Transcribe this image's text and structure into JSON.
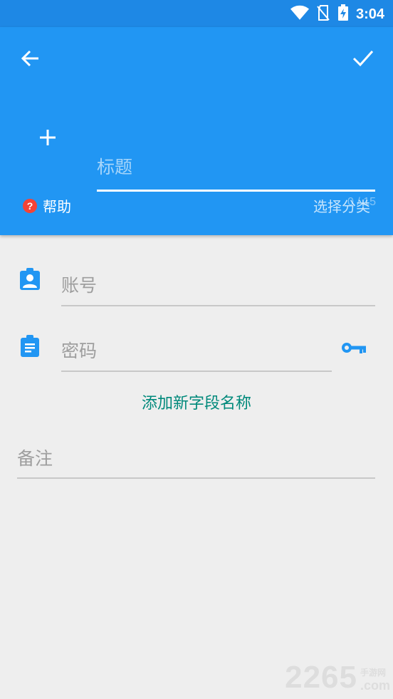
{
  "status_bar": {
    "time": "3:04"
  },
  "header": {
    "title_placeholder": "标题",
    "title_value": "",
    "counter": "0 / 15",
    "help_label": "帮助",
    "category_label": "选择分类"
  },
  "form": {
    "account_placeholder": "账号",
    "password_placeholder": "密码",
    "add_field_label": "添加新字段名称",
    "notes_placeholder": "备注"
  },
  "watermark": {
    "number": "2265",
    "small": "手游网",
    "domain": ".com"
  },
  "colors": {
    "primary": "#2196f3",
    "status_bar": "#1e88e5",
    "accent": "#00897b",
    "help": "#f44336"
  }
}
